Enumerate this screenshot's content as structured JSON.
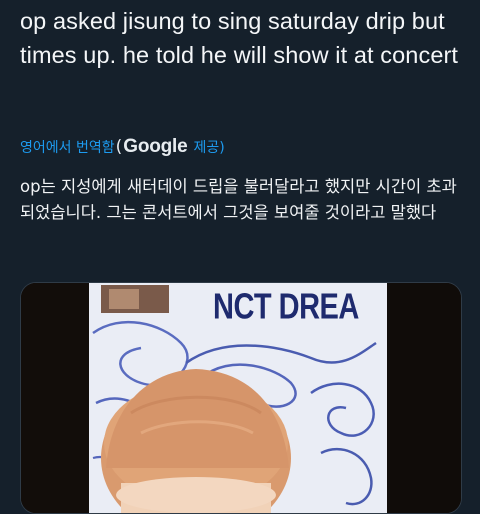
{
  "tweet": {
    "text": "op asked jisung to sing saturday drip but times up. he told he will show it at concert",
    "translation": {
      "label": "영어에서 번역함",
      "provider_paren": "(",
      "provider": "Google",
      "provide_label": "제공)",
      "text": "op는 지성에게 새터데이 드립을 불러달라고 했지만 시간이 초과되었습니다. 그는 콘서트에서 그것을 보여줄 것이라고 말했다"
    },
    "media": {
      "sign_text": "NCT DREA"
    }
  },
  "colors": {
    "background": "#15202b",
    "link": "#1d9bf0",
    "text": "#f4f6f8"
  }
}
